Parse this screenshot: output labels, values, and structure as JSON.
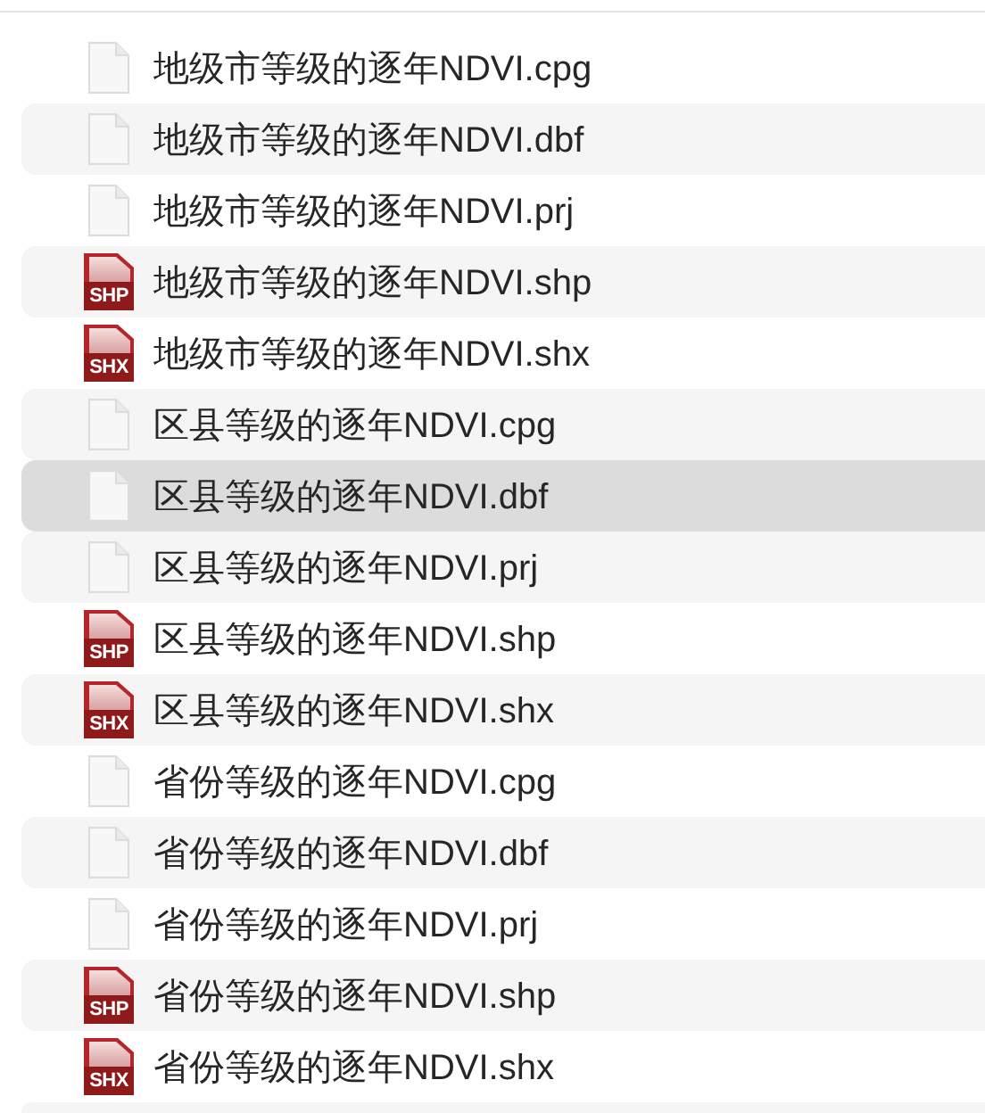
{
  "files": [
    {
      "name": "地级市等级的逐年NDVI.cpg",
      "kind": "plain",
      "selected": false
    },
    {
      "name": "地级市等级的逐年NDVI.dbf",
      "kind": "plain",
      "selected": false
    },
    {
      "name": "地级市等级的逐年NDVI.prj",
      "kind": "plain",
      "selected": false
    },
    {
      "name": "地级市等级的逐年NDVI.shp",
      "kind": "shape",
      "badge": "SHP",
      "selected": false
    },
    {
      "name": "地级市等级的逐年NDVI.shx",
      "kind": "shape",
      "badge": "SHX",
      "selected": false
    },
    {
      "name": "区县等级的逐年NDVI.cpg",
      "kind": "plain",
      "selected": false
    },
    {
      "name": "区县等级的逐年NDVI.dbf",
      "kind": "plain",
      "selected": true
    },
    {
      "name": "区县等级的逐年NDVI.prj",
      "kind": "plain",
      "selected": false
    },
    {
      "name": "区县等级的逐年NDVI.shp",
      "kind": "shape",
      "badge": "SHP",
      "selected": false
    },
    {
      "name": "区县等级的逐年NDVI.shx",
      "kind": "shape",
      "badge": "SHX",
      "selected": false
    },
    {
      "name": "省份等级的逐年NDVI.cpg",
      "kind": "plain",
      "selected": false
    },
    {
      "name": "省份等级的逐年NDVI.dbf",
      "kind": "plain",
      "selected": false
    },
    {
      "name": "省份等级的逐年NDVI.prj",
      "kind": "plain",
      "selected": false
    },
    {
      "name": "省份等级的逐年NDVI.shp",
      "kind": "shape",
      "badge": "SHP",
      "selected": false
    },
    {
      "name": "省份等级的逐年NDVI.shx",
      "kind": "shape",
      "badge": "SHX",
      "selected": false
    }
  ]
}
